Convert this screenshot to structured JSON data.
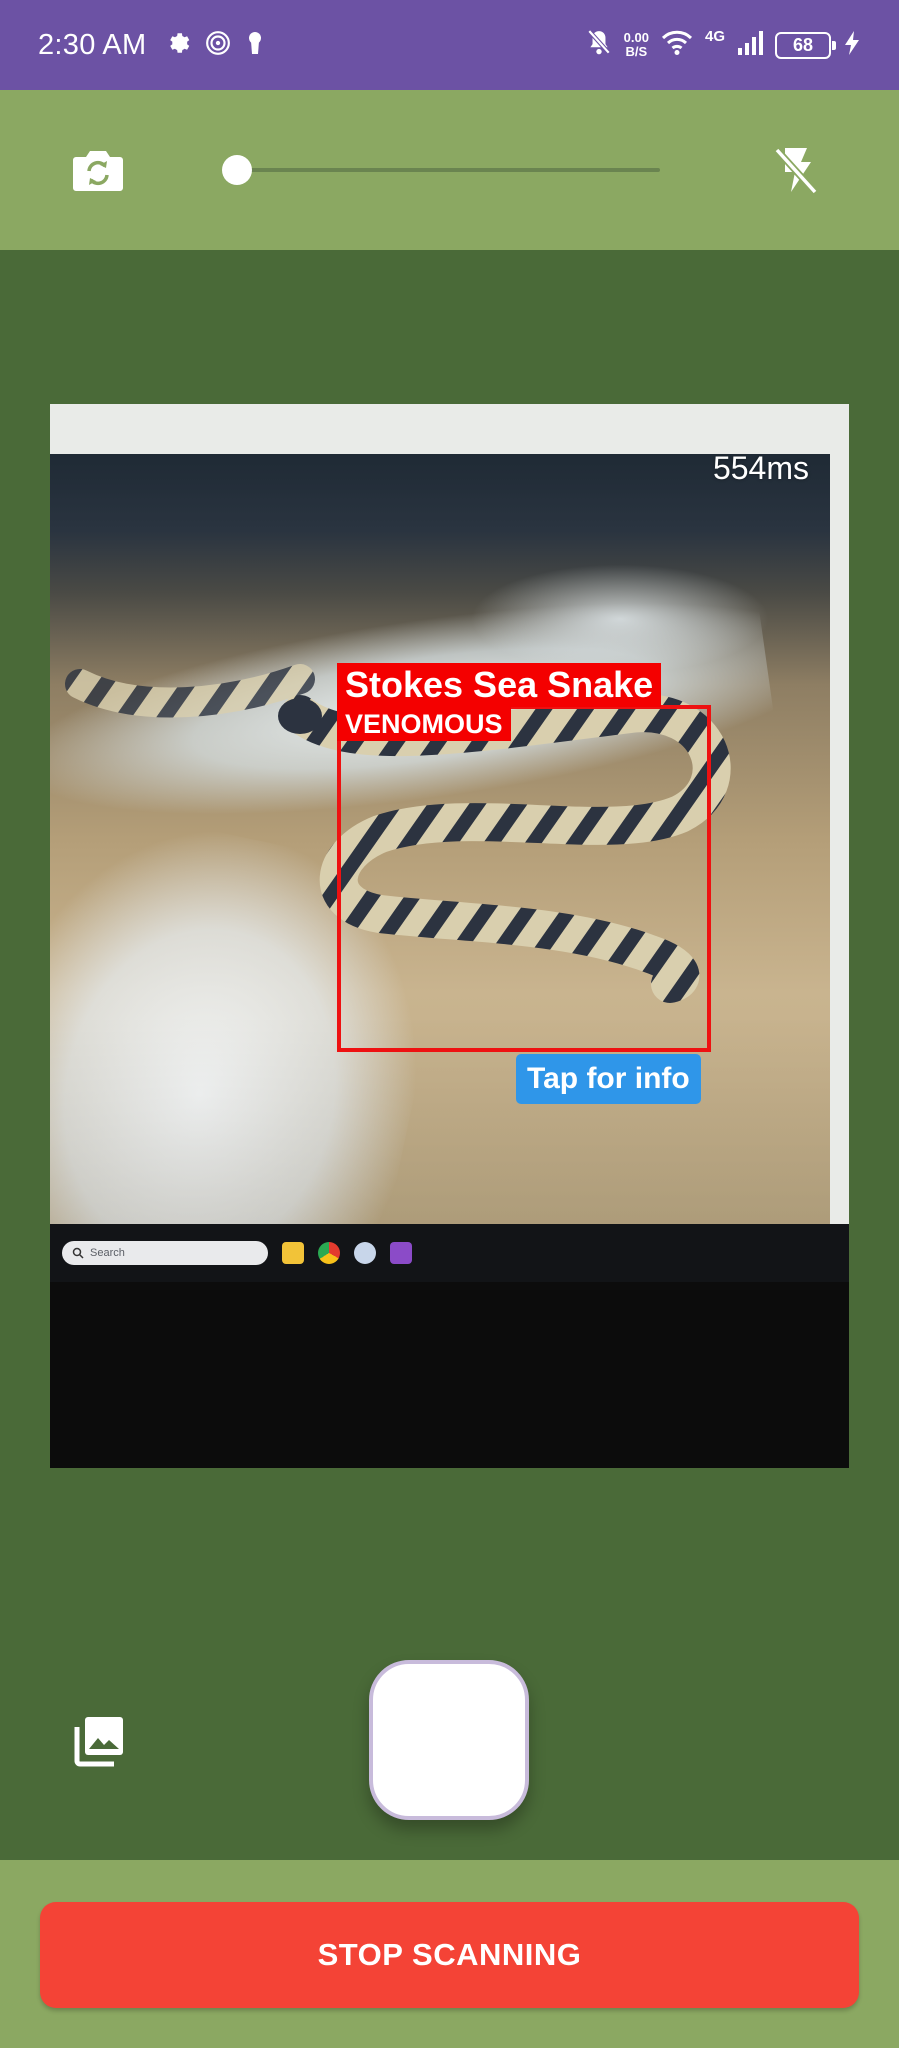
{
  "status_bar": {
    "time": "2:30 AM",
    "net_speed_value": "0.00",
    "net_speed_unit": "B/S",
    "network_type": "4G",
    "battery_level": "68",
    "icons": [
      "gear-icon",
      "fingerprint-icon",
      "keyhole-icon",
      "bell-off-icon",
      "wifi-icon",
      "signal-icon",
      "battery-icon",
      "charging-bolt-icon"
    ]
  },
  "toolbar": {
    "camera_switch_icon": "camera-switch-icon",
    "zoom_level": 0.0,
    "flash_icon": "flash-off-icon"
  },
  "preview": {
    "latency": "554ms",
    "detection": {
      "species": "Stokes Sea Snake",
      "tag": "VENOMOUS",
      "info_label": "Tap for info"
    },
    "taskbar_search_placeholder": "Search"
  },
  "controls": {
    "gallery_icon": "gallery-icon",
    "shutter_icon": "shutter-button"
  },
  "bottom": {
    "stop_label": "STOP SCANNING"
  },
  "colors": {
    "status_bar": "#6c52a4",
    "toolbar": "#8ba862",
    "preview_background": "#4a6a38",
    "detection_box": "#ee1111",
    "info_button": "#2f96e9",
    "stop_button": "#f44336"
  }
}
